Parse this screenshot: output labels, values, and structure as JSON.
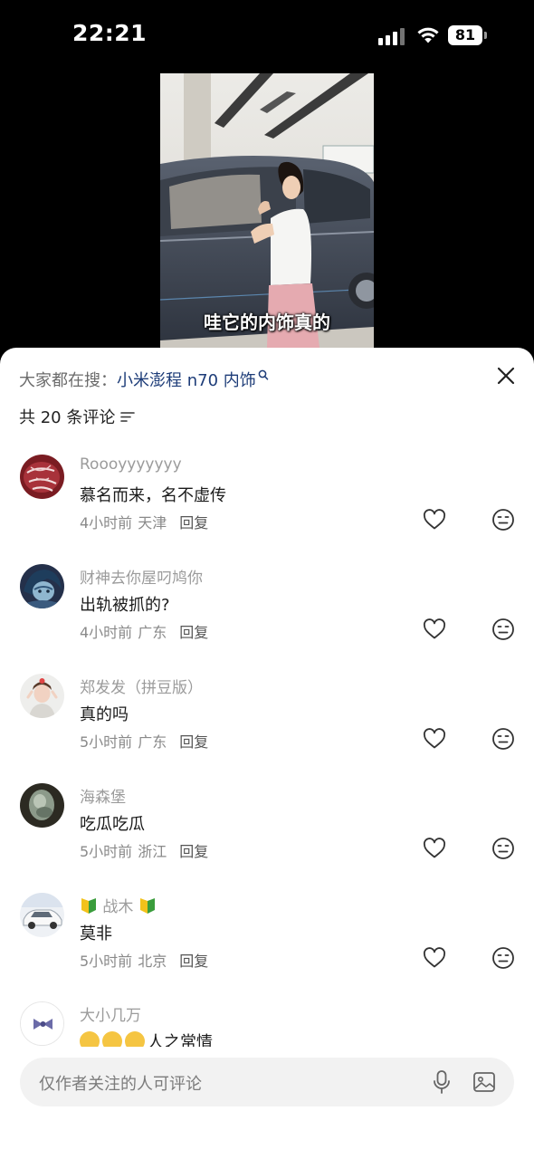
{
  "status_bar": {
    "time": "22:21",
    "battery": "81"
  },
  "video": {
    "caption": "哇它的内饰真的"
  },
  "comments_sheet": {
    "search_prefix": "大家都在搜：",
    "search_term": "小米澎程 n70 内饰",
    "count_label": "共 20 条评论",
    "comments": [
      {
        "username": "Roooyyyyyyy",
        "content": "慕名而来，名不虚传",
        "time": "4小时前",
        "location": "天津",
        "reply": "回复"
      },
      {
        "username": "财神去你屋叼鸠你",
        "content": "出轨被抓的?",
        "time": "4小时前",
        "location": "广东",
        "reply": "回复"
      },
      {
        "username": "郑发发（拼豆版）",
        "content": "真的吗",
        "time": "5小时前",
        "location": "广东",
        "reply": "回复"
      },
      {
        "username": "海森堡",
        "content": "吃瓜吃瓜",
        "time": "5小时前",
        "location": "浙江",
        "reply": "回复"
      },
      {
        "username": "战木",
        "content": "莫非",
        "time": "5小时前",
        "location": "北京",
        "reply": "回复"
      },
      {
        "username": "大小几万",
        "content": "人之常情"
      }
    ],
    "input_placeholder": "仅作者关注的人可评论"
  },
  "colors": {
    "search_term": "#1d3c78",
    "muted_text": "#9b9b9b",
    "sheet_background": "#ffffff",
    "input_background": "#f2f2f2"
  },
  "icons": {
    "like": "heart-outline-icon",
    "dislike": "neutral-face-icon",
    "close": "close-icon",
    "sort": "sort-lines-icon",
    "mic": "microphone-icon",
    "image": "image-icon"
  }
}
